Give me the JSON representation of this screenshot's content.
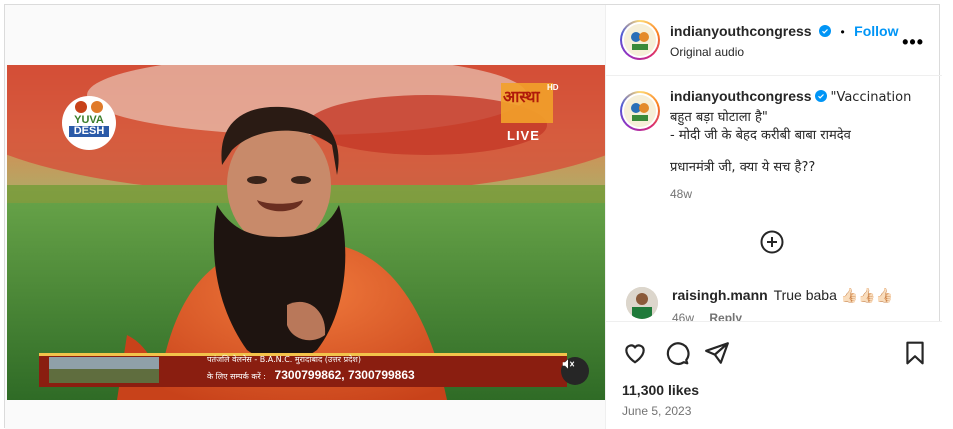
{
  "post": {
    "username": "indianyouthcongress",
    "follow_label": "Follow",
    "separator": "•",
    "audio_label": "Original audio",
    "more_label": "•••"
  },
  "video": {
    "logo_text_1": "YUVA",
    "logo_text_2": "DESH",
    "channel_text": "आस्था",
    "channel_hd": "HD",
    "live_label": "LIVE",
    "ticker_line_1": "पतंजलि वेलनेस - B.A.N.C. मुरादाबाद (उत्तर प्रदेश)",
    "ticker_line_2_prefix": "के लिए सम्पर्क करें :",
    "ticker_phone": "7300799862, 7300799863"
  },
  "caption": {
    "username": "indianyouthcongress",
    "line1": "\"Vaccination बहुत बड़ा घोटाला है\"",
    "line2": "- मोदी जी के बेहद करीबी बाबा रामदेव",
    "line3": "प्रधानमंत्री जी, क्या ये सच है??",
    "time": "48w"
  },
  "comment": {
    "username": "raisingh.mann",
    "text": "True baba 👍🏻👍🏻👍🏻",
    "time": "46w",
    "reply_label": "Reply"
  },
  "stats": {
    "likes": "11,300 likes",
    "date": "June 5, 2023"
  },
  "colors": {
    "accent": "#0095f6",
    "verified": "#0095f6"
  }
}
